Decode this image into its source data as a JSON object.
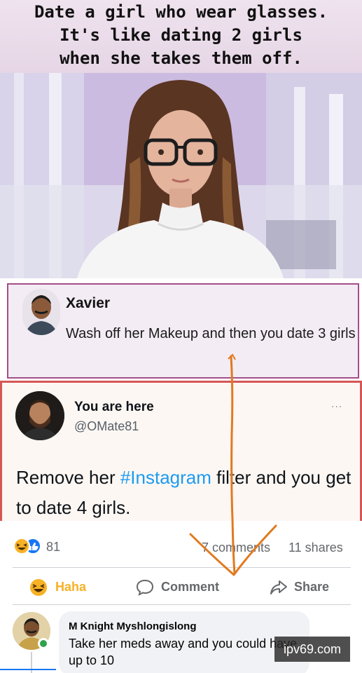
{
  "meme": {
    "caption_line1": "Date a girl who wear glasses.",
    "caption_line2": "It's like dating 2 girls",
    "caption_line3": "when she takes them off."
  },
  "xavier_comment": {
    "name": "Xavier",
    "text": "Wash off her Makeup and then you date 3 girls"
  },
  "tweet": {
    "name": "You are here",
    "handle": "@OMate81",
    "more": "...",
    "text_before": "Remove her ",
    "hashtag": "#Instagram",
    "text_after": " filter and you get to date 4 girls."
  },
  "post_stats": {
    "reaction_count": "81",
    "comments": "7 comments",
    "shares": "11 shares",
    "reaction_icons": [
      "haha-icon",
      "like-icon"
    ]
  },
  "actions": {
    "haha": "Haha",
    "comment": "Comment",
    "share": "Share"
  },
  "comment": {
    "author": "M Knight Myshlongislong",
    "text": "Take her meds away and you could have up to 10"
  },
  "watermark": "ipv69.com",
  "colors": {
    "haha": "#f7b125",
    "like": "#1877f2",
    "hashtag": "#1d9bf0",
    "tweet_border": "#d65555",
    "xavier_border": "#a24f8a",
    "arrow": "#e07a1f",
    "online": "#31a24c"
  }
}
